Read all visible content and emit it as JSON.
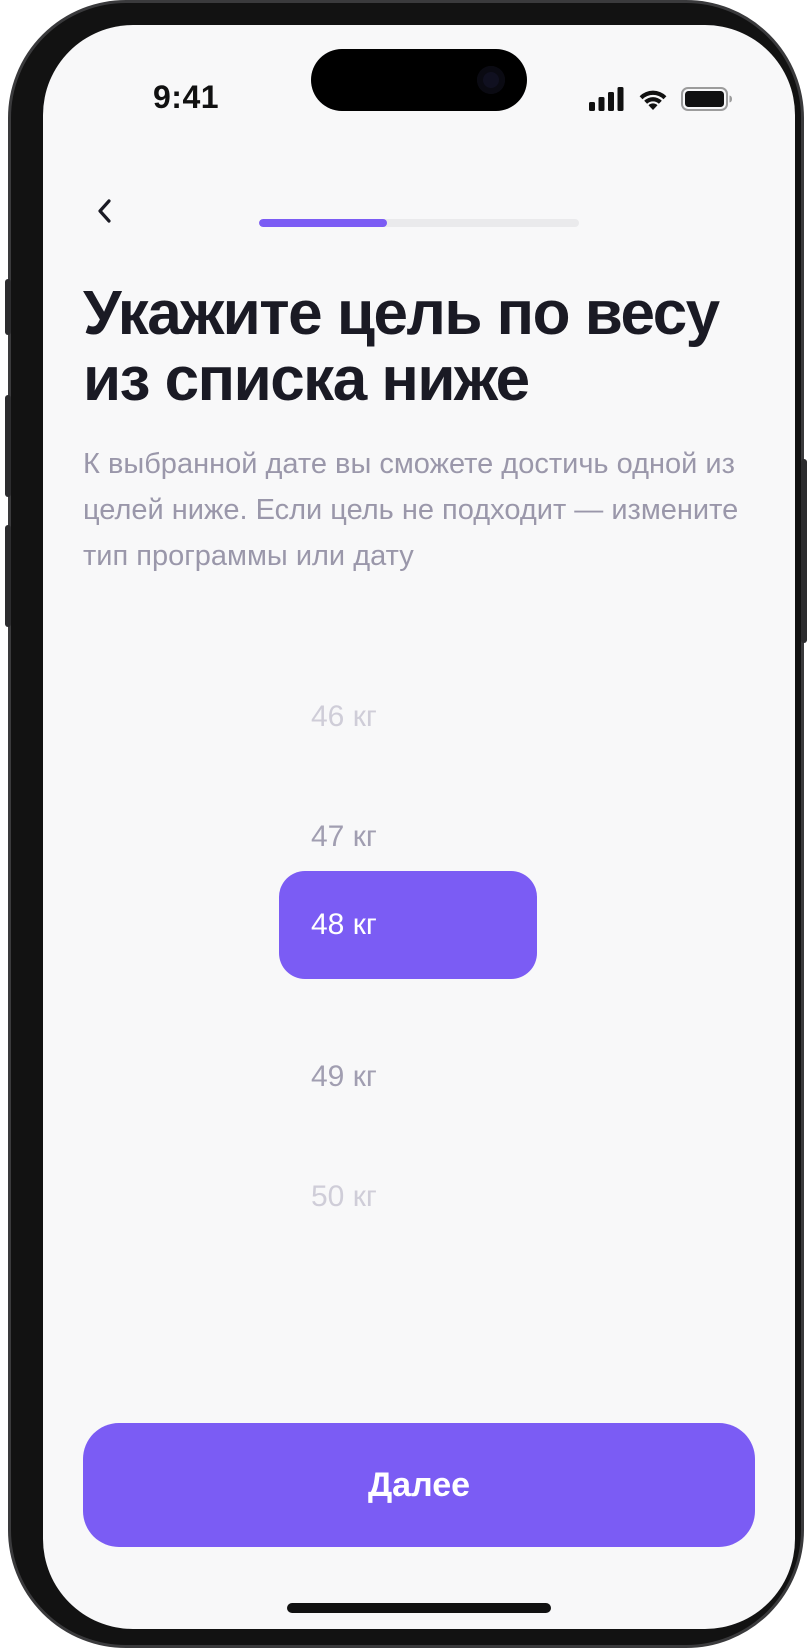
{
  "status_bar": {
    "time": "9:41",
    "icons": [
      "cellular-signal-icon",
      "wifi-icon",
      "battery-icon"
    ]
  },
  "header": {
    "back_icon": "chevron-left-icon",
    "progress_fraction": 0.4
  },
  "content": {
    "title": "Укажите цель по весу из списка ниже",
    "subtitle": "К выбранной дате вы сможете достичь одной из целей ниже. Если цель не подходит — измените тип программы или дату"
  },
  "picker": {
    "items": [
      {
        "label": "46 кг",
        "state": "far"
      },
      {
        "label": "47 кг",
        "state": "near"
      },
      {
        "label": "48 кг",
        "state": "selected"
      },
      {
        "label": "49 кг",
        "state": "near"
      },
      {
        "label": "50 кг",
        "state": "far"
      }
    ]
  },
  "actions": {
    "next_label": "Далее"
  },
  "colors": {
    "accent": "#7b5cf4",
    "background": "#f8f8f9",
    "title": "#1a1a24",
    "muted": "#9a97aa"
  }
}
